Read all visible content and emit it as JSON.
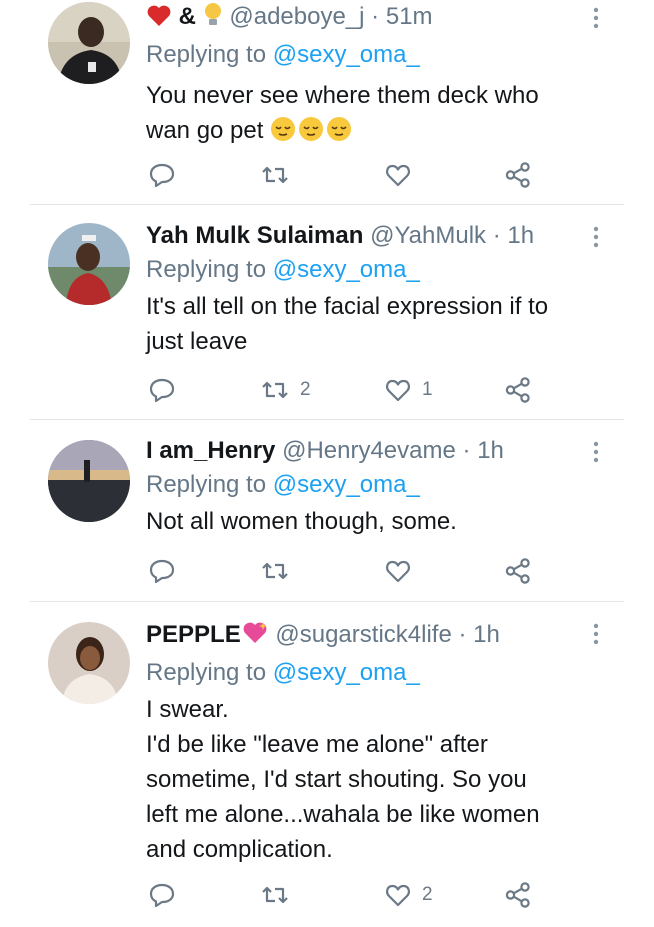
{
  "tweets": [
    {
      "name_prefix": "&",
      "display_name": "",
      "handle": "@adeboye_j",
      "dot": "·",
      "time": "51m",
      "replying_label": "Replying to",
      "replying_handle": "@sexy_oma_",
      "text_lines": [
        "You never see where them deck who",
        "wan go pet"
      ],
      "replies": "",
      "retweets": "",
      "likes": "",
      "avatar_icon": "avatar-man-dark"
    },
    {
      "display_name": "Yah Mulk Sulaiman",
      "handle": "@YahMulk",
      "dot": "·",
      "time": "1h",
      "replying_label": "Replying to",
      "replying_handle": "@sexy_oma_",
      "text_lines": [
        "It's all tell on the facial expression if to",
        "just leave"
      ],
      "replies": "",
      "retweets": "2",
      "likes": "1",
      "avatar_icon": "avatar-man-outdoor"
    },
    {
      "display_name": "I am_Henry",
      "handle": "@Henry4evame",
      "dot": "·",
      "time": "1h",
      "replying_label": "Replying to",
      "replying_handle": "@sexy_oma_",
      "text_lines": [
        "Not all women though, some."
      ],
      "replies": "",
      "retweets": "",
      "likes": "",
      "avatar_icon": "avatar-sunset"
    },
    {
      "display_name": "PEPPLE",
      "handle": "@sugarstick4life",
      "dot": "·",
      "time": "1h",
      "replying_label": "Replying to",
      "replying_handle": "@sexy_oma_",
      "text_lines": [
        "I swear.",
        "I'd be like \"leave me alone\" after",
        "sometime, I'd start shouting. So you",
        "left me alone...wahala be like women",
        "and complication."
      ],
      "replies": "",
      "retweets": "",
      "likes": "2",
      "avatar_icon": "avatar-woman"
    }
  ],
  "colors": {
    "mention": "#1da1f2",
    "muted": "#657786",
    "icon": "#6b7885",
    "divider": "#e3e6e8"
  }
}
